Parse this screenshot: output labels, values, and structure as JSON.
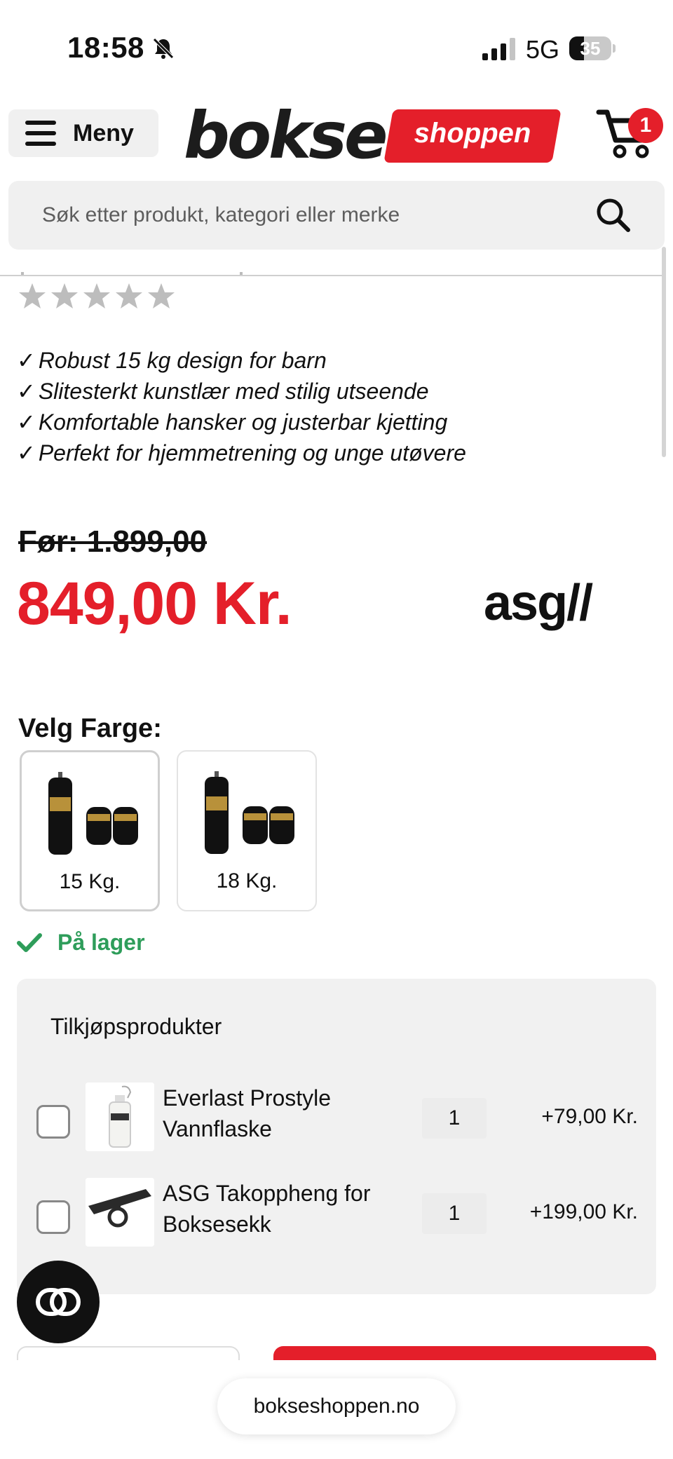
{
  "status_bar": {
    "time": "18:58",
    "network": "5G",
    "battery_level": "35",
    "battery_fraction": 0.35
  },
  "header": {
    "menu_label": "Meny",
    "logo_main": "bokse",
    "logo_tag": "shoppen",
    "cart_count": "1"
  },
  "search": {
    "placeholder": "Søk etter produkt, kategori eller merke"
  },
  "product": {
    "rating_stars": 0,
    "features": [
      "Robust 15 kg design for barn",
      "Slitesterkt kunstlær med stilig utseende",
      "Komfortable hansker og justerbar kjetting",
      "Perfekt for hjemmetrening og unge utøvere"
    ],
    "old_price": "Før: 1.899,00",
    "price": "849,00 Kr.",
    "brand": "asg//"
  },
  "variants": {
    "heading": "Velg Farge:",
    "options": [
      {
        "label": "15 Kg.",
        "selected": true
      },
      {
        "label": "18 Kg.",
        "selected": false
      }
    ]
  },
  "stock": {
    "label": "På lager"
  },
  "addons": {
    "title": "Tilkjøpsprodukter",
    "items": [
      {
        "name": "Everlast Prostyle Vannflaske",
        "qty": "1",
        "price": "+79,00 Kr."
      },
      {
        "name": "ASG Takoppheng for Boksesekk",
        "qty": "1",
        "price": "+199,00 Kr."
      }
    ]
  },
  "browser": {
    "url": "bokseshoppen.no"
  },
  "colors": {
    "brand_red": "#e41f2a",
    "stock_green": "#2e9d5a",
    "star_grey": "#bdbdbd"
  }
}
